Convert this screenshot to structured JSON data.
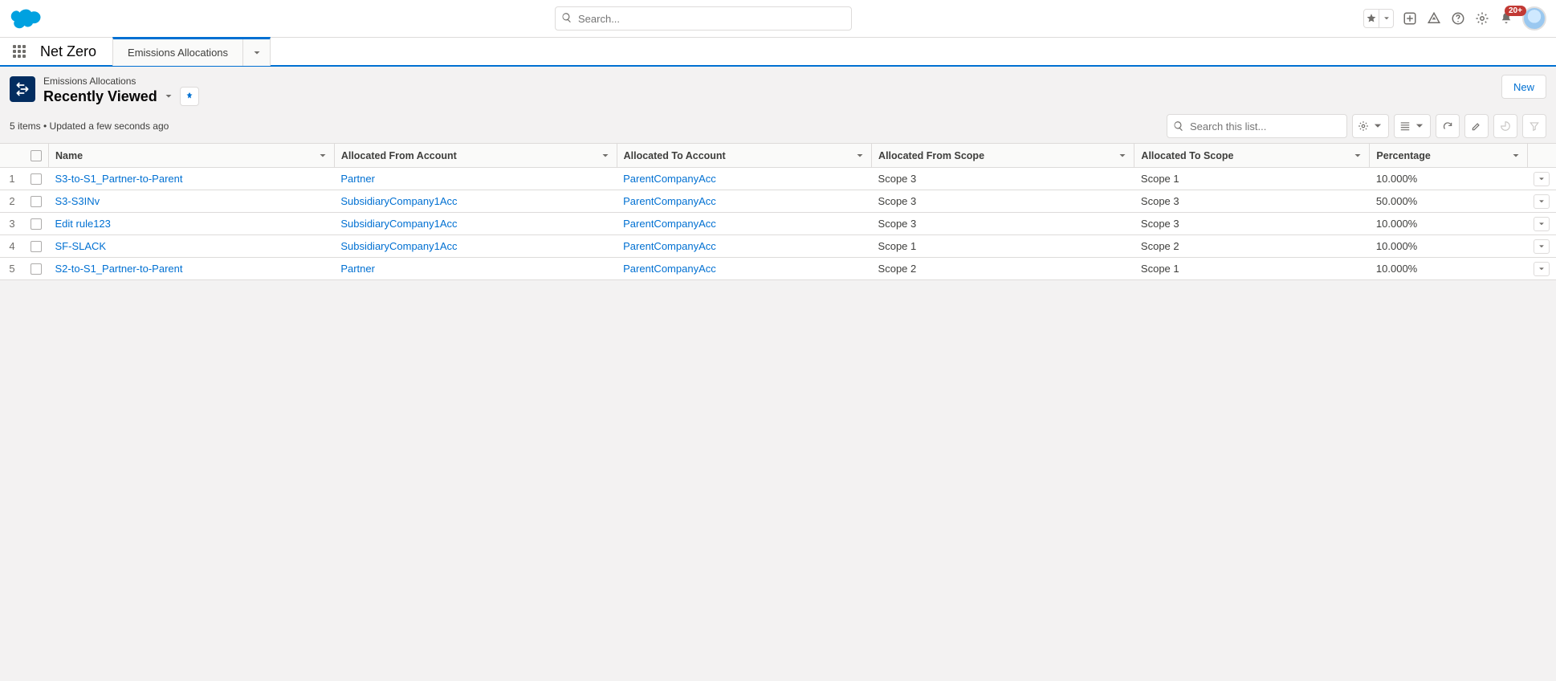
{
  "globalSearch": {
    "placeholder": "Search..."
  },
  "notifications": {
    "count": "20+"
  },
  "nav": {
    "appName": "Net Zero",
    "tab": {
      "label": "Emissions Allocations"
    }
  },
  "pageHeader": {
    "objectLabel": "Emissions Allocations",
    "listViewName": "Recently Viewed",
    "meta": "5 items • Updated a few seconds ago",
    "newButton": "New",
    "listSearchPlaceholder": "Search this list..."
  },
  "columns": {
    "c1": "Name",
    "c2": "Allocated From Account",
    "c3": "Allocated To Account",
    "c4": "Allocated From Scope",
    "c5": "Allocated To Scope",
    "c6": "Percentage"
  },
  "rows": [
    {
      "idx": "1",
      "name": "S3-to-S1_Partner-to-Parent",
      "fromAcc": "Partner",
      "toAcc": "ParentCompanyAcc",
      "fromScope": "Scope 3",
      "toScope": "Scope 1",
      "pct": "10.000%"
    },
    {
      "idx": "2",
      "name": "S3-S3INv",
      "fromAcc": "SubsidiaryCompany1Acc",
      "toAcc": "ParentCompanyAcc",
      "fromScope": "Scope 3",
      "toScope": "Scope 3",
      "pct": "50.000%"
    },
    {
      "idx": "3",
      "name": "Edit rule123",
      "fromAcc": "SubsidiaryCompany1Acc",
      "toAcc": "ParentCompanyAcc",
      "fromScope": "Scope 3",
      "toScope": "Scope 3",
      "pct": "10.000%"
    },
    {
      "idx": "4",
      "name": "SF-SLACK",
      "fromAcc": "SubsidiaryCompany1Acc",
      "toAcc": "ParentCompanyAcc",
      "fromScope": "Scope 1",
      "toScope": "Scope 2",
      "pct": "10.000%"
    },
    {
      "idx": "5",
      "name": "S2-to-S1_Partner-to-Parent",
      "fromAcc": "Partner",
      "toAcc": "ParentCompanyAcc",
      "fromScope": "Scope 2",
      "toScope": "Scope 1",
      "pct": "10.000%"
    }
  ]
}
